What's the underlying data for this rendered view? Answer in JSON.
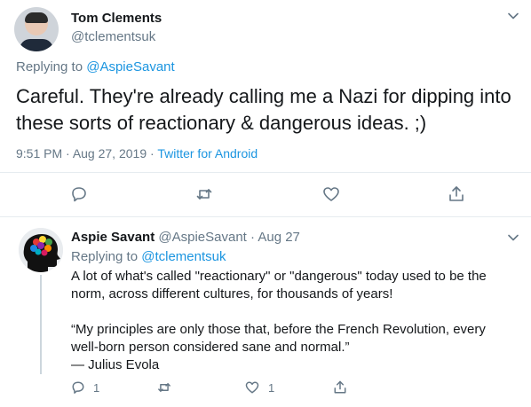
{
  "main_tweet": {
    "author_name": "Tom Clements",
    "author_handle": "@tclementsuk",
    "replying_prefix": "Replying to ",
    "replying_to": "@AspieSavant",
    "text": "Careful. They're already calling me a Nazi for dipping into these sorts of reactionary & dangerous ideas. ;)",
    "time": "9:51 PM",
    "separator": " · ",
    "date": "Aug 27, 2019",
    "source": "Twitter for Android",
    "actions": {
      "reply_icon": "reply-icon",
      "retweet_icon": "retweet-icon",
      "like_icon": "like-icon",
      "share_icon": "share-icon"
    }
  },
  "reply_tweet": {
    "author_name": "Aspie Savant",
    "author_handle": "@AspieSavant",
    "dot": " · ",
    "date": "Aug 27",
    "replying_prefix": "Replying to ",
    "replying_to": "@tclementsuk",
    "text": "A lot of what's called \"reactionary\" or \"dangerous\" today used to be the norm, across different cultures, for thousands of years!\n\n“My principles are only those that, before the French Revolution, every well-born person considered sane and normal.”\n— Julius Evola",
    "reply_count": "1",
    "like_count": "1"
  },
  "colors": {
    "link": "#1b95e0",
    "secondary": "#657786",
    "text": "#14171a"
  }
}
